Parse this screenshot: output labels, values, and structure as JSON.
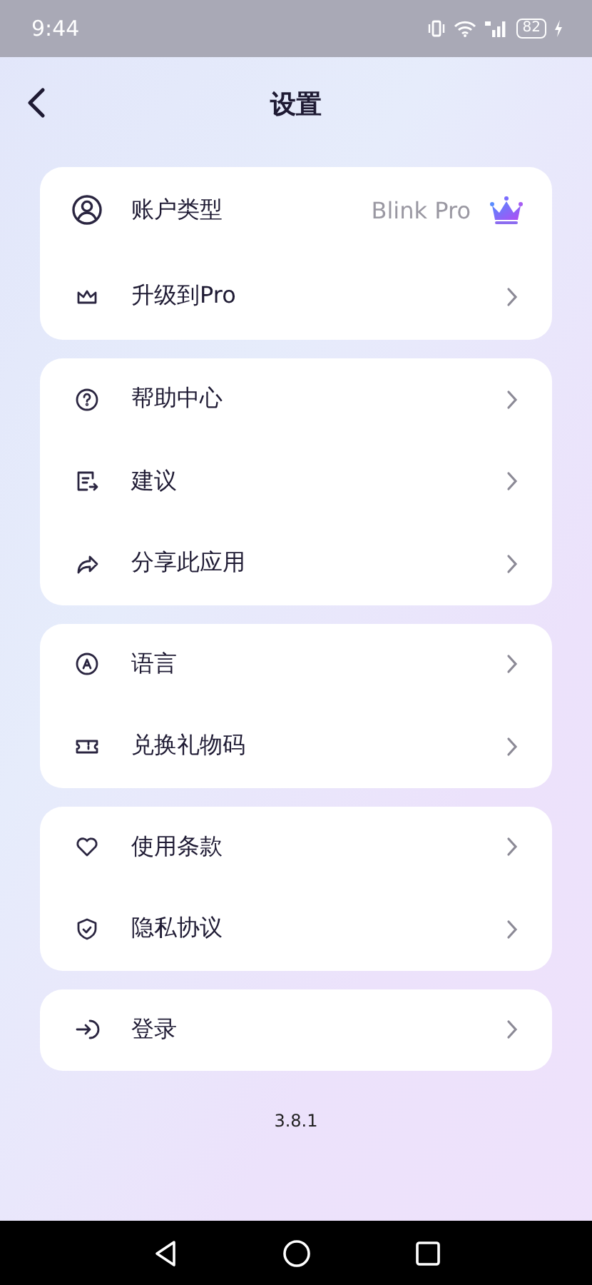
{
  "status_bar": {
    "time": "9:44",
    "battery": "82"
  },
  "header": {
    "title": "设置"
  },
  "sections": [
    {
      "items": [
        {
          "kind": "value",
          "label": "账户类型",
          "value": "Blink Pro"
        },
        {
          "kind": "link",
          "label": "升级到Pro"
        }
      ]
    },
    {
      "items": [
        {
          "kind": "link",
          "label": "帮助中心"
        },
        {
          "kind": "link",
          "label": "建议"
        },
        {
          "kind": "link",
          "label": "分享此应用"
        }
      ]
    },
    {
      "items": [
        {
          "kind": "link",
          "label": "语言"
        },
        {
          "kind": "link",
          "label": "兑换礼物码"
        }
      ]
    },
    {
      "items": [
        {
          "kind": "link",
          "label": "使用条款"
        },
        {
          "kind": "link",
          "label": "隐私协议"
        }
      ]
    },
    {
      "items": [
        {
          "kind": "link",
          "label": "登录"
        }
      ]
    }
  ],
  "version": "3.8.1"
}
